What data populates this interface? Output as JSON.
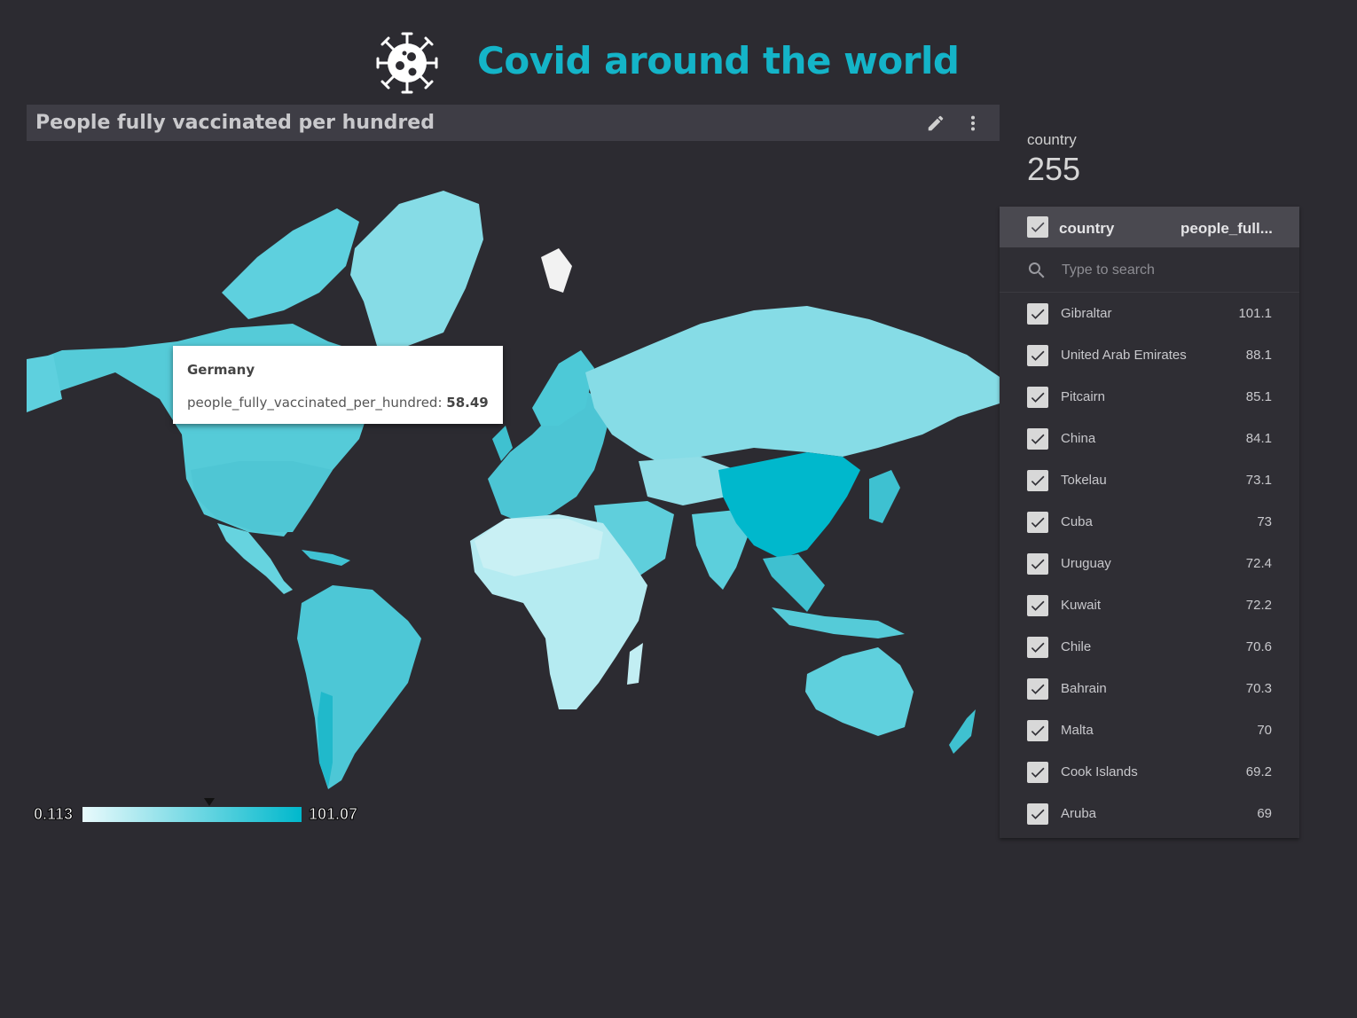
{
  "header": {
    "title": "Covid around the world",
    "logo_icon": "virus-icon"
  },
  "map_panel": {
    "title": "People fully vaccinated per hundred",
    "edit_icon": "pencil-icon",
    "menu_icon": "more-vert-icon",
    "colors": {
      "low": "#e9fafc",
      "high": "#00b8cc",
      "mid": "#5dd0dc",
      "land_missing": "#f2f2f2"
    },
    "tooltip": {
      "country": "Germany",
      "metric": "people_fully_vaccinated_per_hundred:",
      "value": "58.49"
    },
    "legend": {
      "min": "0.113",
      "max": "101.07",
      "marker_fraction": 0.58
    }
  },
  "scorecard": {
    "label": "country",
    "value": "255"
  },
  "filter": {
    "col_country": "country",
    "col_metric": "people_full...",
    "search_placeholder": "Type to search",
    "items": [
      {
        "name": "Gibraltar",
        "value": "101.1"
      },
      {
        "name": "United Arab Emirates",
        "value": "88.1"
      },
      {
        "name": "Pitcairn",
        "value": "85.1"
      },
      {
        "name": "China",
        "value": "84.1"
      },
      {
        "name": "Tokelau",
        "value": "73.1"
      },
      {
        "name": "Cuba",
        "value": "73"
      },
      {
        "name": "Uruguay",
        "value": "72.4"
      },
      {
        "name": "Kuwait",
        "value": "72.2"
      },
      {
        "name": "Chile",
        "value": "70.6"
      },
      {
        "name": "Bahrain",
        "value": "70.3"
      },
      {
        "name": "Malta",
        "value": "70"
      },
      {
        "name": "Cook Islands",
        "value": "69.2"
      },
      {
        "name": "Aruba",
        "value": "69"
      }
    ]
  }
}
